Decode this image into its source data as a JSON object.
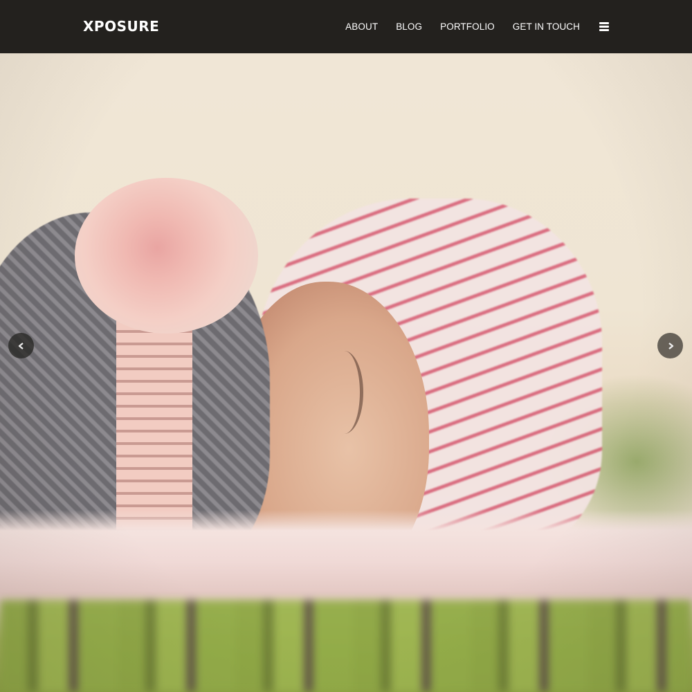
{
  "header": {
    "logo": "XPOSURE",
    "nav": [
      {
        "label": "ABOUT"
      },
      {
        "label": "BLOG"
      },
      {
        "label": "PORTFOLIO"
      },
      {
        "label": "GET IN TOUCH"
      }
    ],
    "menu_icon": "hamburger-menu-icon"
  },
  "hero": {
    "image_description": "Sleeping baby wearing grey knit hat with pink crochet flower, lying on a pink striped blanket on grass",
    "prev_icon": "chevron-left-icon",
    "next_icon": "chevron-right-icon"
  },
  "colors": {
    "header_bg": "#23211e",
    "header_text": "#ffffff"
  }
}
